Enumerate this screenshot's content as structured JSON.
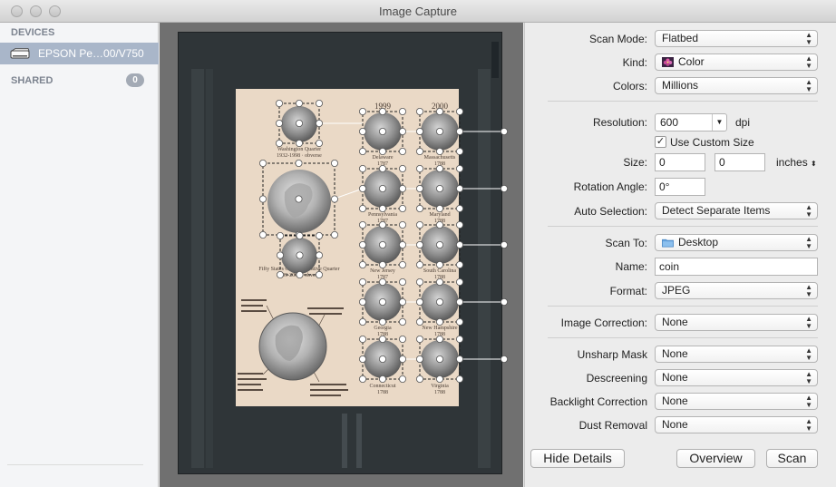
{
  "window": {
    "title": "Image Capture"
  },
  "sidebar": {
    "devices_heading": "DEVICES",
    "device_name": "EPSON Pe…00/V750",
    "shared_heading": "SHARED",
    "shared_count": "0"
  },
  "preview": {
    "years": [
      "1999",
      "2000"
    ],
    "left_captions": [
      "Washington Quarter",
      "1932-1998 · obverse",
      "Fifty States Commemorative Quarter",
      "1999-2008 · obverse"
    ],
    "col1_labels": [
      [
        "Delaware",
        "1787"
      ],
      [
        "Pennsylvania",
        "1787"
      ],
      [
        "New Jersey",
        "1787"
      ],
      [
        "Georgia",
        "1788"
      ],
      [
        "Connecticut",
        "1788"
      ]
    ],
    "col2_labels": [
      [
        "Massachusetts",
        "1788"
      ],
      [
        "Maryland",
        "1788"
      ],
      [
        "South Carolina",
        "1788"
      ],
      [
        "New Hampshire",
        "1788"
      ],
      [
        "Virginia",
        "1788"
      ]
    ]
  },
  "details": {
    "scan_mode": {
      "label": "Scan Mode:",
      "value": "Flatbed"
    },
    "kind": {
      "label": "Kind:",
      "value": "Color"
    },
    "colors": {
      "label": "Colors:",
      "value": "Millions"
    },
    "resolution": {
      "label": "Resolution:",
      "value": "600",
      "unit": "dpi"
    },
    "custom_size": {
      "label": "Use Custom Size",
      "checked": true
    },
    "size": {
      "label": "Size:",
      "width": "0",
      "height": "0",
      "unit": "inches"
    },
    "rotation": {
      "label": "Rotation Angle:",
      "value": "0°"
    },
    "auto_selection": {
      "label": "Auto Selection:",
      "value": "Detect Separate Items"
    },
    "scan_to": {
      "label": "Scan To:",
      "value": "Desktop"
    },
    "name": {
      "label": "Name:",
      "value": "coin"
    },
    "format": {
      "label": "Format:",
      "value": "JPEG"
    },
    "image_correction": {
      "label": "Image Correction:",
      "value": "None"
    },
    "unsharp_mask": {
      "label": "Unsharp Mask",
      "value": "None"
    },
    "descreening": {
      "label": "Descreening",
      "value": "None"
    },
    "backlight": {
      "label": "Backlight Correction",
      "value": "None"
    },
    "dust_removal": {
      "label": "Dust Removal",
      "value": "None"
    }
  },
  "buttons": {
    "hide_details": "Hide Details",
    "overview": "Overview",
    "scan": "Scan"
  },
  "icons": {
    "device": "scanner-icon",
    "kind": "color-flower-icon",
    "scan_to": "folder-icon",
    "popup": "updown-arrows-icon"
  },
  "colors": {
    "sidebar_selection": "#a9b6c9",
    "document": "#ead9c6",
    "scanner_bed": "#2f3538"
  }
}
